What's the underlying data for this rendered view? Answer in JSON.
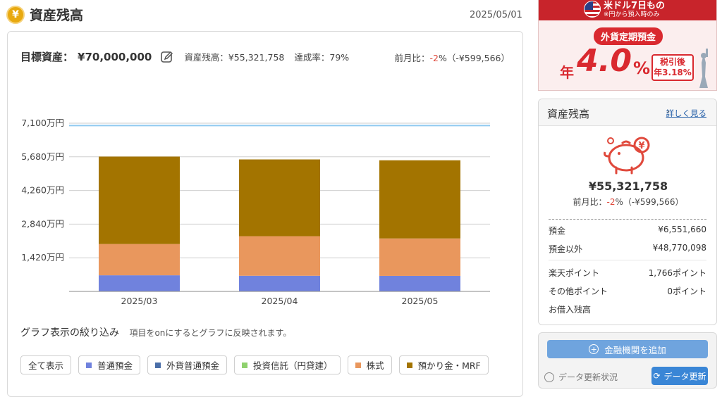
{
  "header": {
    "icon": "yen-coin-icon",
    "title": "資産残高",
    "date": "2025/05/01"
  },
  "summary": {
    "goal_label": "目標資産：",
    "goal_value": "¥70,000,000",
    "balance_text": "資産残高：¥55,321,758",
    "rate_text": "達成率：79%",
    "mom_label": "前月比：",
    "mom_pct": "-2",
    "mom_rest": "%（-¥599,566）"
  },
  "chart_data": {
    "type": "bar",
    "stacked": true,
    "categories": [
      "2025/03",
      "2025/04",
      "2025/05"
    ],
    "ytick_labels": [
      "1,420万円",
      "2,840万円",
      "4,260万円",
      "5,680万円",
      "7,100万円"
    ],
    "ytick_values": [
      1420,
      2840,
      4260,
      5680,
      7100
    ],
    "ylim": [
      0,
      7100
    ],
    "goal_line": 7000,
    "series": [
      {
        "name": "普通預金",
        "color": "#7082dd",
        "values": [
          680,
          660,
          655
        ]
      },
      {
        "name": "外貨普通預金",
        "color": "#4a6ea8",
        "values": [
          0,
          0,
          0
        ]
      },
      {
        "name": "投資信託（円貸建）",
        "color": "#8fd16e",
        "values": [
          0,
          0,
          0
        ]
      },
      {
        "name": "株式",
        "color": "#e9975d",
        "values": [
          1320,
          1670,
          1580
        ]
      },
      {
        "name": "預かり金・MRF",
        "color": "#a37400",
        "values": [
          3690,
          3240,
          3300
        ]
      }
    ],
    "grid": true
  },
  "filter": {
    "title": "グラフ表示の絞り込み",
    "note": "項目をonにするとグラフに反映されます。",
    "all_label": "全て表示",
    "chips": [
      {
        "label": "普通預金",
        "color": "#7082dd"
      },
      {
        "label": "外貨普通預金",
        "color": "#4a6ea8"
      },
      {
        "label": "投資信託（円貸建）",
        "color": "#8fd16e"
      },
      {
        "label": "株式",
        "color": "#e9975d"
      },
      {
        "label": "預かり金・MRF",
        "color": "#a37400"
      }
    ]
  },
  "ad": {
    "top_main": "米ドル7日もの",
    "top_sub": "※円から預入時のみ",
    "badge": "外貨定期預金",
    "rate_prefix": "年",
    "rate": "4.0",
    "pct": "%",
    "tax_line1": "税引後",
    "tax_line2": "年3.18%"
  },
  "side": {
    "title": "資産残高",
    "link": "詳しく見る",
    "total": "¥55,321,758",
    "mom_label": "前月比：",
    "mom_pct": "-2",
    "mom_rest": "%（-¥599,566）",
    "rows": [
      {
        "label": "預金",
        "value": "¥6,551,660"
      },
      {
        "label": "預金以外",
        "value": "¥48,770,098"
      },
      {
        "label": "楽天ポイント",
        "value": "1,766ポイント"
      },
      {
        "label": "その他ポイント",
        "value": "0ポイント"
      },
      {
        "label": "お借入残高",
        "value": ""
      }
    ],
    "add_button": "金融機関を追加",
    "update_status": "データ更新状況",
    "update_button": "データ更新"
  },
  "colors": {
    "accent": "#e0493c",
    "link": "#245fa8",
    "button": "#6fa4de",
    "brand_red": "#c8242b"
  }
}
